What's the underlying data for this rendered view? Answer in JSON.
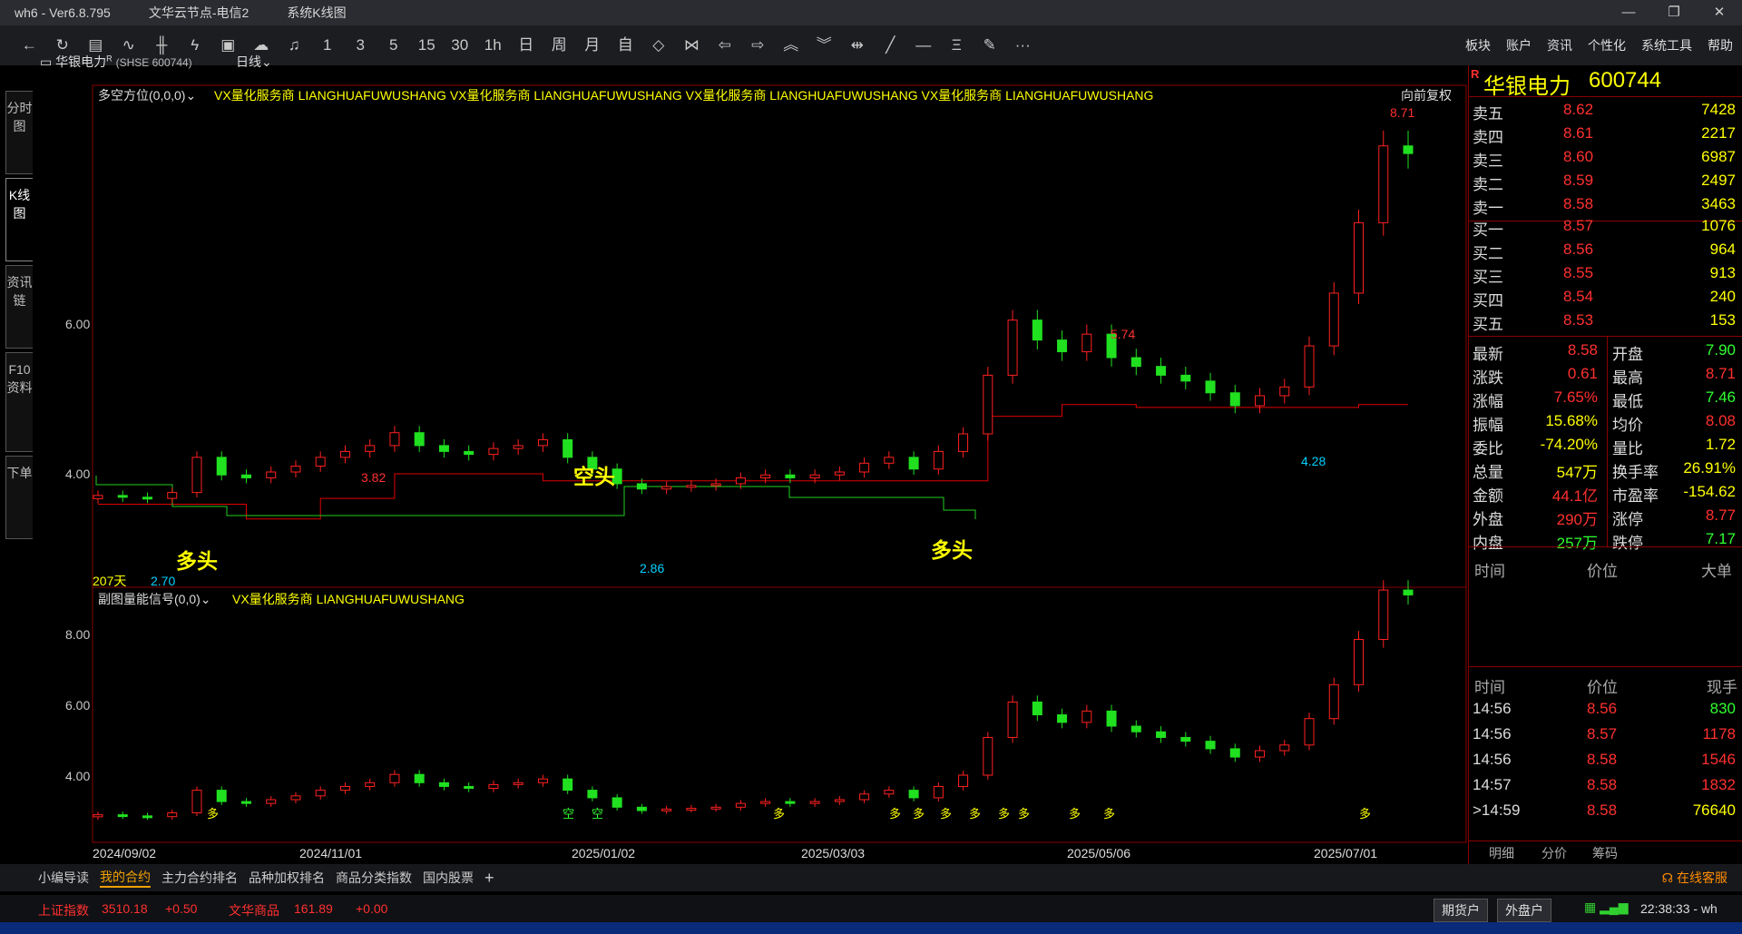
{
  "window": {
    "title": "wh6 - Ver6.8.795",
    "server": "文华云节点-电信2",
    "view": "系统K线图"
  },
  "toolbar": {
    "icons": [
      "back-arrow-icon",
      "refresh-icon",
      "table-icon",
      "line-chart-icon",
      "bar-chart-icon",
      "candle-icon",
      "layout-icon",
      "cloud-icon",
      "bell-icon"
    ],
    "periods": [
      "1",
      "3",
      "5",
      "15",
      "30",
      "1h",
      "日",
      "周",
      "月",
      "自"
    ],
    "tools": [
      "zoom-in-icon",
      "zoom-out-icon",
      "left-icon",
      "right-icon",
      "up-icon",
      "down-icon",
      "split-icon",
      "draw-line-icon",
      "hline-icon",
      "text-icon",
      "eraser-icon",
      "more-icon"
    ]
  },
  "menu": [
    "板块",
    "账户",
    "资讯",
    "个性化",
    "系统工具",
    "帮助"
  ],
  "side_tabs": [
    "分时图",
    "K线图",
    "资讯链",
    "F10资料",
    "下单"
  ],
  "chart_header": {
    "name": "华银电力",
    "code": "(SHSE 600744)",
    "period": "日线",
    "mark": "R"
  },
  "main_panel": {
    "indicator": "多空方位(0,0,0)",
    "sponsor": "VX量化服务商",
    "tag": "LIANGHUAFUWUSHANG",
    "right_label": "向前复权",
    "y_ticks": [
      "6.00",
      "4.00"
    ],
    "days_label": "207天",
    "annotations": {
      "high1": "3.82",
      "low1": "2.70",
      "low2": "2.86",
      "high2": "5.74",
      "low3": "4.28",
      "high3": "8.71"
    },
    "signals": {
      "long1": "多头",
      "short1": "空头",
      "long2": "多头"
    }
  },
  "sub_panel": {
    "indicator": "副图量能信号(0,0)",
    "sponsor": "VX量化服务商",
    "tag": "LIANGHUAFUWUSHANG",
    "y_ticks": [
      "8.00",
      "6.00",
      "4.00"
    ],
    "sig_long": "多",
    "sig_short": "空"
  },
  "x_axis": [
    "2024/09/02",
    "2024/11/01",
    "2025/01/02",
    "2025/03/03",
    "2025/05/06",
    "2025/07/01"
  ],
  "quote": {
    "name": "华银电力",
    "code": "600744",
    "mark": "R",
    "asks": [
      {
        "label": "卖五",
        "price": "8.62",
        "vol": "7428"
      },
      {
        "label": "卖四",
        "price": "8.61",
        "vol": "2217"
      },
      {
        "label": "卖三",
        "price": "8.60",
        "vol": "6987"
      },
      {
        "label": "卖二",
        "price": "8.59",
        "vol": "2497"
      },
      {
        "label": "卖一",
        "price": "8.58",
        "vol": "3463"
      }
    ],
    "bids": [
      {
        "label": "买一",
        "price": "8.57",
        "vol": "1076"
      },
      {
        "label": "买二",
        "price": "8.56",
        "vol": "964"
      },
      {
        "label": "买三",
        "price": "8.55",
        "vol": "913"
      },
      {
        "label": "买四",
        "price": "8.54",
        "vol": "240"
      },
      {
        "label": "买五",
        "price": "8.53",
        "vol": "153"
      }
    ],
    "stats": [
      {
        "l": "最新",
        "v": "8.58",
        "c": "#ff3030",
        "l2": "开盘",
        "v2": "7.90",
        "c2": "#30ff30"
      },
      {
        "l": "涨跌",
        "v": "0.61",
        "c": "#ff3030",
        "l2": "最高",
        "v2": "8.71",
        "c2": "#ff3030"
      },
      {
        "l": "涨幅",
        "v": "7.65%",
        "c": "#ff3030",
        "l2": "最低",
        "v2": "7.46",
        "c2": "#30ff30"
      },
      {
        "l": "振幅",
        "v": "15.68%",
        "c": "#ffff00",
        "l2": "均价",
        "v2": "8.08",
        "c2": "#ff3030"
      },
      {
        "l": "委比",
        "v": "-74.20%",
        "c": "#ffff00",
        "l2": "量比",
        "v2": "1.72",
        "c2": "#ffff00"
      },
      {
        "l": "总量",
        "v": "547万",
        "c": "#ffff00",
        "l2": "换手率",
        "v2": "26.91%",
        "c2": "#ffff00"
      },
      {
        "l": "金额",
        "v": "44.1亿",
        "c": "#ff3030",
        "l2": "市盈率",
        "v2": "-154.62",
        "c2": "#ffff00"
      },
      {
        "l": "外盘",
        "v": "290万",
        "c": "#ff3030",
        "l2": "涨停",
        "v2": "8.77",
        "c2": "#ff3030"
      },
      {
        "l": "内盘",
        "v": "257万",
        "c": "#30ff30",
        "l2": "跌停",
        "v2": "7.17",
        "c2": "#30ff30"
      }
    ],
    "detail_head": [
      "时间",
      "价位",
      "大单"
    ],
    "ticks_head": [
      "时间",
      "价位",
      "现手"
    ],
    "ticks": [
      {
        "t": "14:56",
        "p": "8.56",
        "v": "830",
        "vc": "#30ff30"
      },
      {
        "t": "14:56",
        "p": "8.57",
        "v": "1178",
        "vc": "#ff3030"
      },
      {
        "t": "14:56",
        "p": "8.58",
        "v": "1546",
        "vc": "#ff3030"
      },
      {
        "t": "14:57",
        "p": "8.58",
        "v": "1832",
        "vc": "#ff3030"
      },
      {
        "t": ">14:59",
        "p": "8.58",
        "v": "76640",
        "vc": "#ffff00"
      }
    ],
    "tabs": [
      "明细",
      "分价",
      "筹码"
    ]
  },
  "bottom_tabs": [
    "小编导读",
    "我的合约",
    "主力合约排名",
    "品种加权排名",
    "商品分类指数",
    "国内股票",
    "+"
  ],
  "service": "在线客服",
  "status": {
    "idx1": "上证指数",
    "v1": "3510.18",
    "c1": "+0.50",
    "idx2": "文华商品",
    "v2": "161.89",
    "c2": "+0.00",
    "btn1": "期货户",
    "btn2": "外盘户",
    "time": "22:38:33 - wh"
  },
  "chart_data": {
    "type": "candlestick",
    "series": [
      {
        "name": "华银电力",
        "approx_close": [
          2.75,
          2.72,
          2.7,
          2.8,
          3.4,
          3.1,
          3.05,
          3.15,
          3.25,
          3.4,
          3.5,
          3.6,
          3.82,
          3.6,
          3.5,
          3.45,
          3.55,
          3.6,
          3.7,
          3.4,
          3.2,
          2.95,
          2.86,
          2.9,
          2.92,
          2.95,
          3.05,
          3.1,
          3.05,
          3.1,
          3.15,
          3.3,
          3.4,
          3.2,
          3.5,
          3.8,
          4.8,
          5.74,
          5.4,
          5.2,
          5.5,
          5.1,
          4.95,
          4.8,
          4.7,
          4.5,
          4.28,
          4.45,
          4.6,
          5.3,
          6.2,
          7.4,
          8.71,
          8.58
        ]
      }
    ],
    "ylim": [
      2.5,
      9.0
    ]
  }
}
